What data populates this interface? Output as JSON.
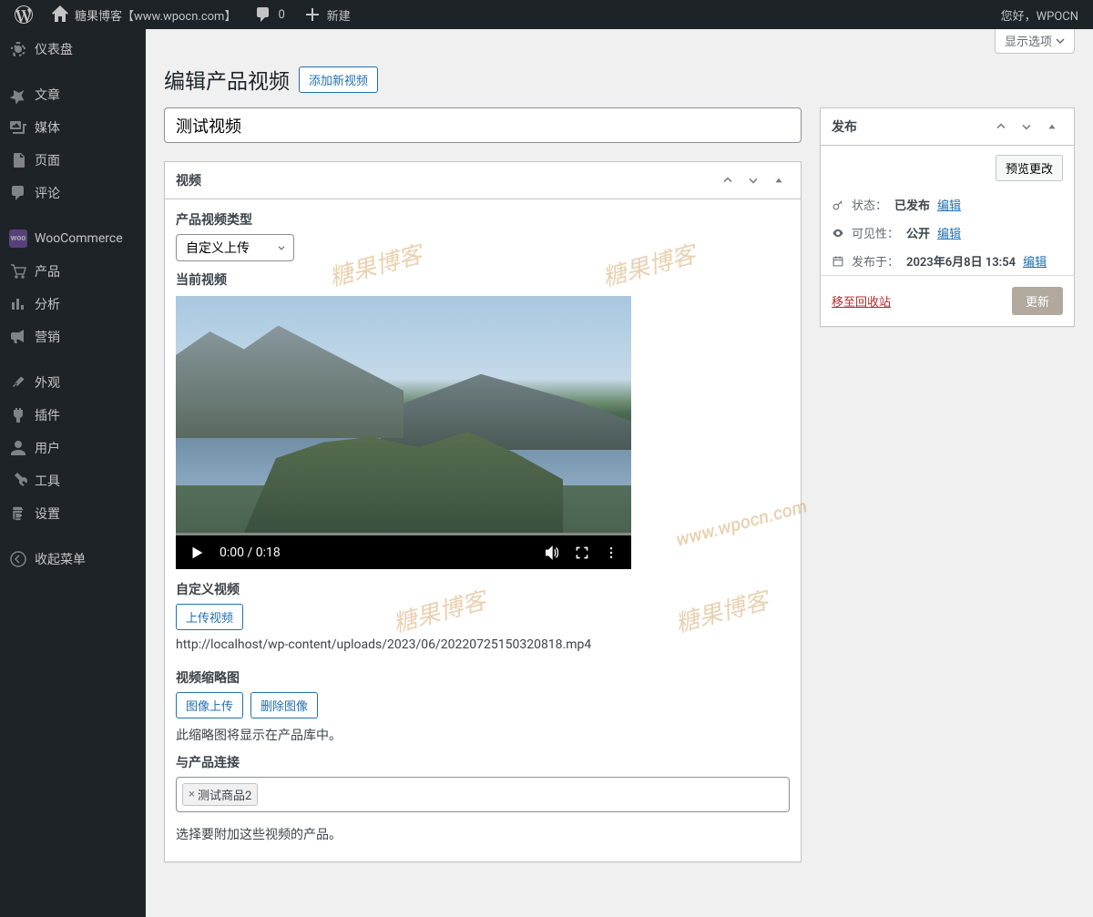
{
  "adminbar": {
    "site_name": "糖果博客【www.wpocn.com】",
    "comments": "0",
    "new": "新建",
    "greeting": "您好，WPOCN"
  },
  "screen_options": "显示选项",
  "sidebar": {
    "items": [
      {
        "label": "仪表盘",
        "icon": "dashboard"
      },
      {
        "label": "文章",
        "icon": "pin"
      },
      {
        "label": "媒体",
        "icon": "media"
      },
      {
        "label": "页面",
        "icon": "page"
      },
      {
        "label": "评论",
        "icon": "comment"
      },
      {
        "label": "WooCommerce",
        "icon": "woo"
      },
      {
        "label": "产品",
        "icon": "product"
      },
      {
        "label": "分析",
        "icon": "analytics"
      },
      {
        "label": "营销",
        "icon": "marketing"
      },
      {
        "label": "外观",
        "icon": "appearance"
      },
      {
        "label": "插件",
        "icon": "plugins"
      },
      {
        "label": "用户",
        "icon": "users"
      },
      {
        "label": "工具",
        "icon": "tools"
      },
      {
        "label": "设置",
        "icon": "settings"
      },
      {
        "label": "收起菜单",
        "icon": "collapse"
      }
    ]
  },
  "page": {
    "heading": "编辑产品视频",
    "add_new": "添加新视频",
    "title_value": "测试视频"
  },
  "video_box": {
    "title": "视频",
    "type_label": "产品视频类型",
    "type_value": "自定义上传",
    "current_label": "当前视频",
    "time": "0:00 / 0:18",
    "custom_label": "自定义视频",
    "upload_btn": "上传视频",
    "url": "http://localhost/wp-content/uploads/2023/06/20220725150320818.mp4",
    "thumb_label": "视频缩略图",
    "thumb_upload": "图像上传",
    "thumb_delete": "删除图像",
    "thumb_help": "此缩略图将显示在产品库中。",
    "link_label": "与产品连接",
    "link_tag": "测试商品2",
    "link_help": "选择要附加这些视频的产品。"
  },
  "publish": {
    "title": "发布",
    "preview": "预览更改",
    "status_label": "状态：",
    "status_value": "已发布",
    "visibility_label": "可见性：",
    "visibility_value": "公开",
    "published_label": "发布于：",
    "published_value": "2023年6月8日 13:54",
    "edit": "编辑",
    "trash": "移至回收站",
    "update": "更新"
  },
  "watermark_text": "糖果博客",
  "watermark_url": "www.wpocn.com"
}
